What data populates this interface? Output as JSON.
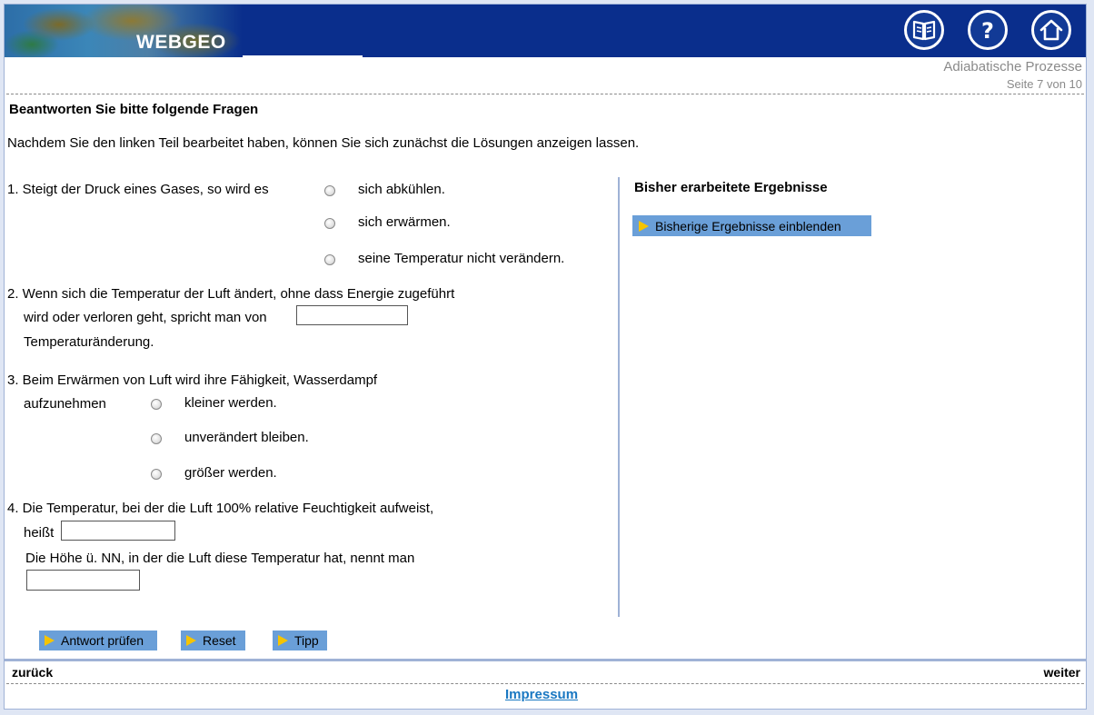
{
  "header": {
    "brand": "WEBGEO",
    "icons": [
      "book-icon",
      "help-icon",
      "home-icon"
    ]
  },
  "page": {
    "module_title": "Adiabatische Prozesse",
    "page_indicator": "Seite 7 von 10",
    "heading": "Beantworten Sie bitte folgende Fragen",
    "intro": "Nachdem Sie den linken Teil bearbeitet haben, können Sie sich zunächst die Lösungen anzeigen lassen."
  },
  "questions": {
    "q1": {
      "text": "1. Steigt der Druck eines Gases, so wird es",
      "options": [
        "sich abkühlen.",
        "sich erwärmen.",
        "seine Temperatur nicht verändern."
      ]
    },
    "q2": {
      "line1": "2. Wenn sich die Temperatur der Luft ändert, ohne dass Energie zugeführt",
      "line2": "wird oder verloren geht, spricht man von",
      "line3": "Temperaturänderung.",
      "input_value": ""
    },
    "q3": {
      "line1": "3. Beim Erwärmen von Luft wird ihre Fähigkeit,  Wasserdampf",
      "line2": "aufzunehmen",
      "options": [
        "kleiner werden.",
        "unverändert bleiben.",
        "größer werden."
      ]
    },
    "q4": {
      "line1": "4. Die Temperatur, bei der die Luft 100% relative Feuchtigkeit aufweist,",
      "line2": "heißt",
      "line3": "Die Höhe ü. NN, in der die Luft diese Temperatur hat, nennt man",
      "input1_value": "",
      "input2_value": ""
    }
  },
  "right_panel": {
    "heading": "Bisher erarbeitete Ergebnisse",
    "show_results_label": "Bisherige Ergebnisse einblenden"
  },
  "buttons": {
    "check": "Antwort prüfen",
    "reset": "Reset",
    "tip": "Tipp"
  },
  "footer": {
    "back": "zurück",
    "next": "weiter",
    "impressum": "Impressum"
  },
  "colors": {
    "header_bg": "#0a2e8c",
    "button_bg": "#6a9fd8",
    "button_arrow": "#f6c400",
    "link": "#1a78c2",
    "muted_text": "#8a8a8a"
  }
}
